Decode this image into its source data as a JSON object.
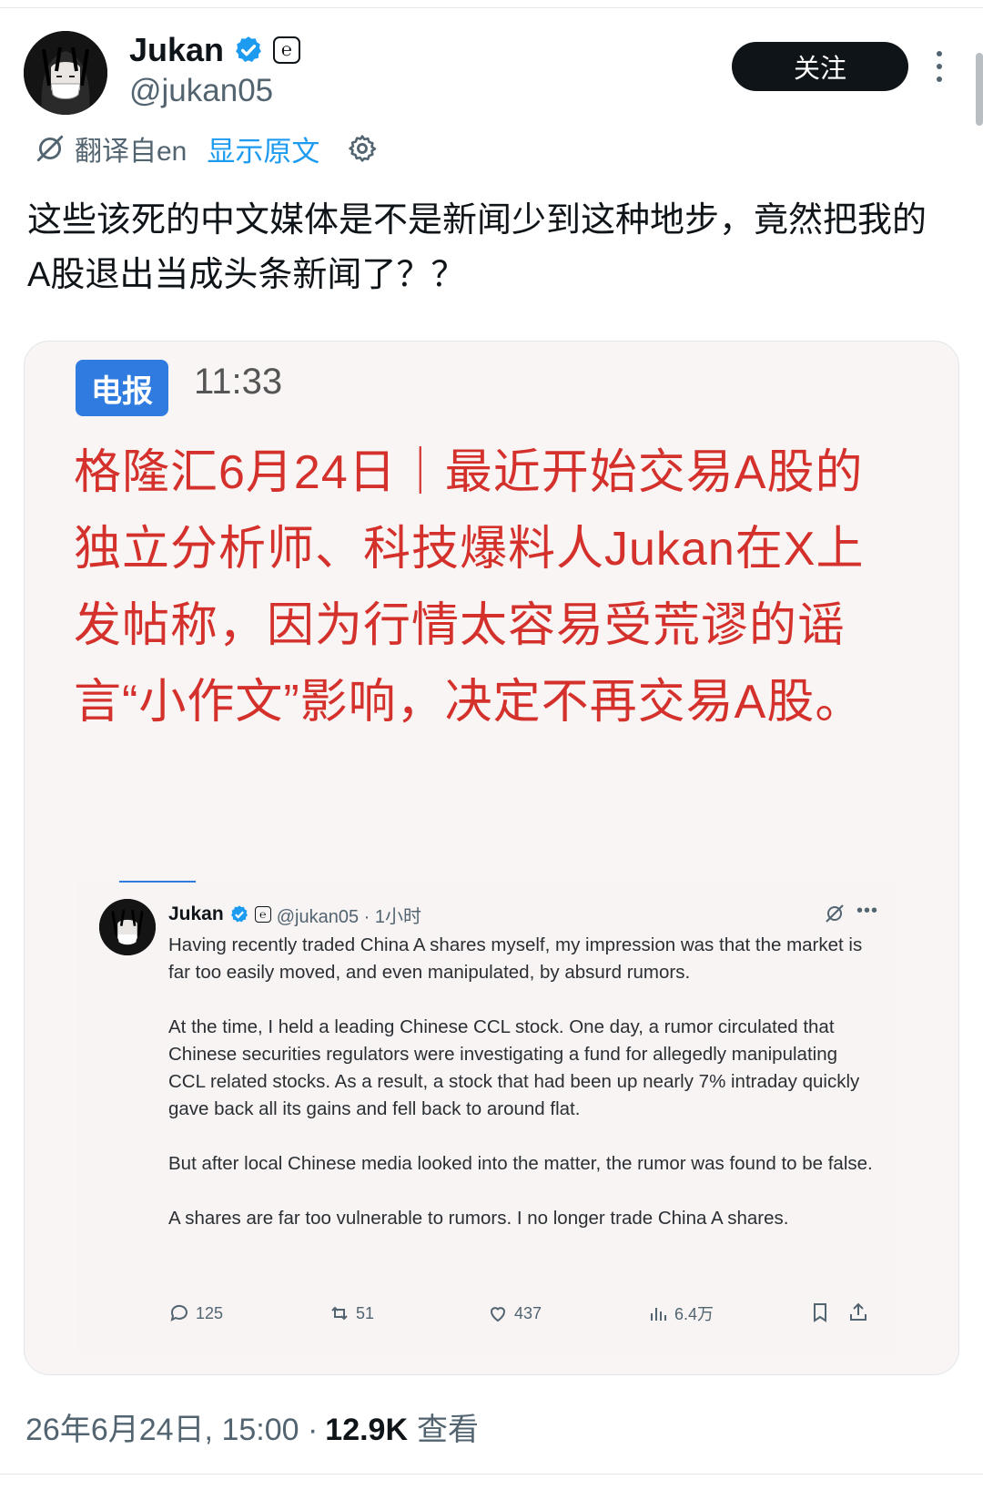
{
  "author": {
    "name": "Jukan",
    "handle": "@jukan05",
    "affiliate_icon": "e-affiliate-icon",
    "verified_icon": "verified-badge-icon"
  },
  "follow_button": "关注",
  "translation": {
    "label": "翻译自en",
    "show_original": "显示原文"
  },
  "tweet_text": "这些该死的中文媒体是不是新闻少到这种地步，竟然把我的A股退出当成头条新闻了？？",
  "image": {
    "badge": "电报",
    "time": "11:33",
    "headline": "格隆汇6月24日｜最近开始交易A股的独立分析师、科技爆料人Jukan在X上发帖称，因为行情太容易受荒谬的谣言“小作文”影响，决定不再交易A股。",
    "embedded_tweet": {
      "name": "Jukan",
      "handle_time": "@jukan05 · 1小时",
      "paragraphs": [
        "Having recently traded China A shares myself, my impression was that the market is far too easily moved, and even manipulated, by absurd rumors.",
        "At the time, I held a leading Chinese CCL stock. One day, a rumor circulated that Chinese securities regulators were investigating a fund for allegedly manipulating CCL related stocks. As a result, a stock that had been up nearly 7% intraday quickly gave back all its gains and fell back to around flat.",
        "But after local Chinese media looked into the matter, the rumor was found to be false.",
        "A shares are far too vulnerable to rumors. I no longer trade China A shares."
      ],
      "replies": "125",
      "reposts": "51",
      "likes": "437",
      "views": "6.4万"
    }
  },
  "footer": {
    "datetime": "26年6月24日, 15:00 ·",
    "views_count": "12.9K",
    "views_label": "查看"
  },
  "colors": {
    "accent": "#1d9bf0",
    "headline_red": "#d4312c",
    "badge_blue": "#2f7be0",
    "text_primary": "#0f1419",
    "text_secondary": "#536471"
  }
}
